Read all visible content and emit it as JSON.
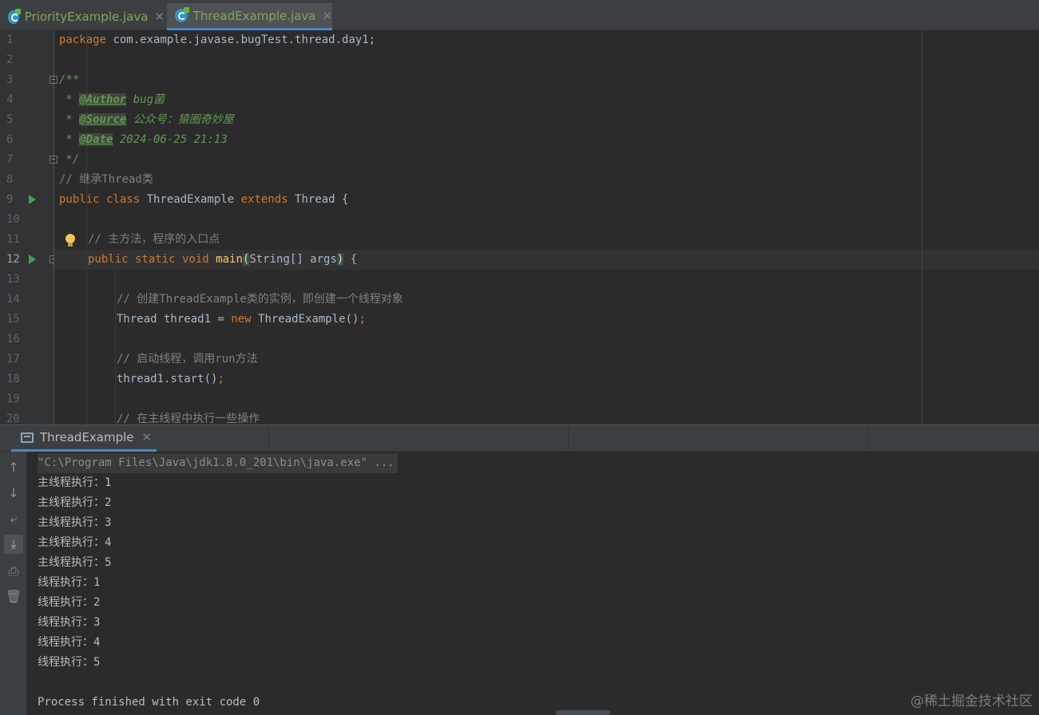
{
  "tabs": [
    {
      "label": "PriorityExample.java",
      "active": false
    },
    {
      "label": "ThreadExample.java",
      "active": true
    }
  ],
  "editor": {
    "current_line": "12",
    "lines": [
      {
        "n": "1"
      },
      {
        "n": "2"
      },
      {
        "n": "3"
      },
      {
        "n": "4"
      },
      {
        "n": "5"
      },
      {
        "n": "6"
      },
      {
        "n": "7"
      },
      {
        "n": "8"
      },
      {
        "n": "9"
      },
      {
        "n": "10"
      },
      {
        "n": "11"
      },
      {
        "n": "12"
      },
      {
        "n": "13"
      },
      {
        "n": "14"
      },
      {
        "n": "15"
      },
      {
        "n": "16"
      },
      {
        "n": "17"
      },
      {
        "n": "18"
      },
      {
        "n": "19"
      },
      {
        "n": "20"
      }
    ],
    "code": {
      "l1_kw": "package",
      "l1_rest": " com.example.javase.bugTest.thread.day1;",
      "l3": "/**",
      "l4_star": " * ",
      "l4_tag": "@Author",
      "l4_val": " bug菌",
      "l5_star": " * ",
      "l5_tag": "@Source",
      "l5_val": " 公众号：猿圈奇妙屋",
      "l6_star": " * ",
      "l6_tag": "@Date",
      "l6_val": " 2024-06-25 21:13",
      "l7": " */",
      "l8": "// 继承Thread类",
      "l9_kw1": "public class",
      "l9_name": " ThreadExample ",
      "l9_kw2": "extends",
      "l9_rest": " Thread {",
      "l11": "// 主方法，程序的入口点",
      "l12_kw": "public static void",
      "l12_fn": "main",
      "l12_open": "(",
      "l12_args": "String[] args",
      "l12_close": ")",
      "l12_brace": " {",
      "l14": "// 创建ThreadExample类的实例，即创建一个线程对象",
      "l15_a": "Thread thread1 = ",
      "l15_kw": "new",
      "l15_b": " ThreadExample()",
      "l15_semi": ";",
      "l17": "// 启动线程，调用run方法",
      "l18_a": "thread1.start()",
      "l18_semi": ";",
      "l20": "// 在主线程中执行一些操作"
    }
  },
  "run_panel": {
    "tab_label": "ThreadExample",
    "output": [
      "\"C:\\Program Files\\Java\\jdk1.8.0_201\\bin\\java.exe\" ...",
      "主线程执行：1",
      "主线程执行：2",
      "主线程执行：3",
      "主线程执行：4",
      "主线程执行：5",
      "线程执行：1",
      "线程执行：2",
      "线程执行：3",
      "线程执行：4",
      "线程执行：5",
      "",
      "Process finished with exit code 0"
    ],
    "tools": [
      "arrow-up-icon",
      "arrow-down-icon",
      "soft-wrap-icon",
      "scroll-to-end-icon",
      "print-icon",
      "trash-icon"
    ]
  },
  "watermark": "@稀土掘金技术社区",
  "colors": {
    "keyword": "#cc7832",
    "comment": "#808080",
    "doc": "#629755",
    "function": "#ffc66d",
    "accent": "#4a88c7"
  }
}
